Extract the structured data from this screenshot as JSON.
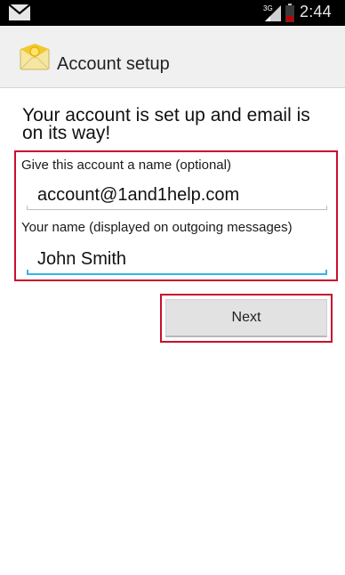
{
  "status_bar": {
    "time": "2:44",
    "network": "3G",
    "notification_icon": "envelope-icon",
    "signal_icon": "signal-icon",
    "battery_icon": "battery-icon"
  },
  "action_bar": {
    "title": "Account setup",
    "icon": "email-app-icon"
  },
  "main": {
    "headline": "Your account is set up and email is on its way!",
    "account_name": {
      "label": "Give this account a name (optional)",
      "value": "account@1and1help.com"
    },
    "your_name": {
      "label": "Your name (displayed on outgoing messages)",
      "value": "John Smith"
    },
    "next_label": "Next"
  },
  "colors": {
    "highlight": "#c8102e",
    "focus_underline": "#33b5e5",
    "status_bar": "#000000",
    "action_bar": "#f0f0f0"
  }
}
